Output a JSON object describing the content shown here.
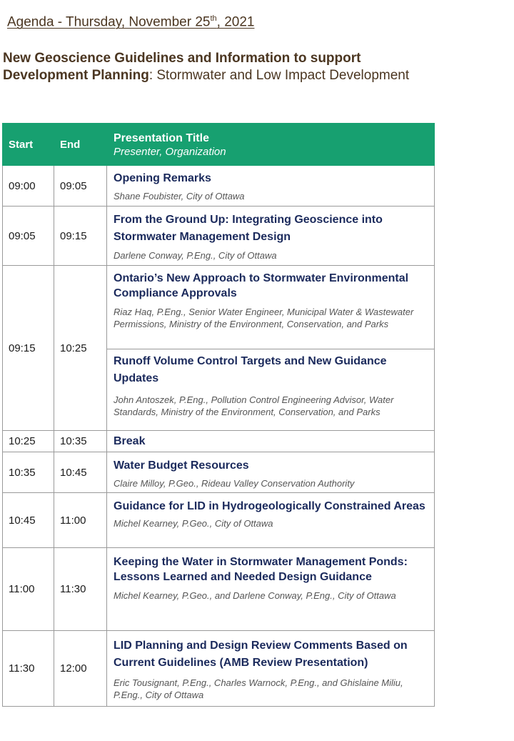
{
  "header": {
    "date_prefix": "Agenda - Thursday, November 25",
    "date_sup": "th",
    "date_suffix": ", 2021",
    "title_bold": "New Geoscience Guidelines and Information to support Development Planning",
    "title_rest": ": Stormwater and Low Impact Development"
  },
  "table": {
    "headers": {
      "start": "Start",
      "end": "End",
      "title": "Presentation Title",
      "presenter": "Presenter, Organization"
    },
    "rows": [
      {
        "start": "09:00",
        "end": "09:05",
        "title": "Opening Remarks",
        "presenter": "Shane Foubister, City of Ottawa"
      },
      {
        "start": "09:05",
        "end": "09:15",
        "title": "From the Ground Up: Integrating Geoscience into Stormwater Management Design",
        "presenter": "Darlene Conway, P.Eng., City of Ottawa"
      },
      {
        "start": "09:15",
        "end": "10:25",
        "title": "Ontario’s New Approach to Stormwater Environmental Compliance Approvals",
        "presenter": "Riaz Haq, P.Eng., Senior Water Engineer, Municipal Water & Wastewater Permissions, Ministry of the Environment, Conservation, and Parks",
        "title_b": "Runoff Volume Control Targets and New Guidance Updates",
        "presenter_b": "John Antoszek, P.Eng., Pollution Control Engineering Advisor, Water Standards, Ministry of the Environment, Conservation, and Parks"
      },
      {
        "start": "10:25",
        "end": "10:35",
        "title": "Break"
      },
      {
        "start": "10:35",
        "end": "10:45",
        "title": "Water Budget Resources",
        "presenter": "Claire Milloy, P.Geo., Rideau Valley Conservation Authority"
      },
      {
        "start": "10:45",
        "end": "11:00",
        "title": "Guidance for LID in Hydrogeologically Constrained Areas",
        "presenter": "Michel Kearney, P.Geo., City of Ottawa"
      },
      {
        "start": "11:00",
        "end": "11:30",
        "title": "Keeping the Water in Stormwater Management Ponds: Lessons Learned and Needed Design Guidance",
        "presenter": "Michel Kearney, P.Geo., and Darlene Conway, P.Eng., City of Ottawa"
      },
      {
        "start": "11:30",
        "end": "12:00",
        "title": "LID Planning and Design Review Comments Based on Current Guidelines (AMB Review Presentation)",
        "presenter": "Eric Tousignant, P.Eng., Charles Warnock, P.Eng., and Ghislaine Miliu, P.Eng., City of Ottawa"
      }
    ]
  }
}
